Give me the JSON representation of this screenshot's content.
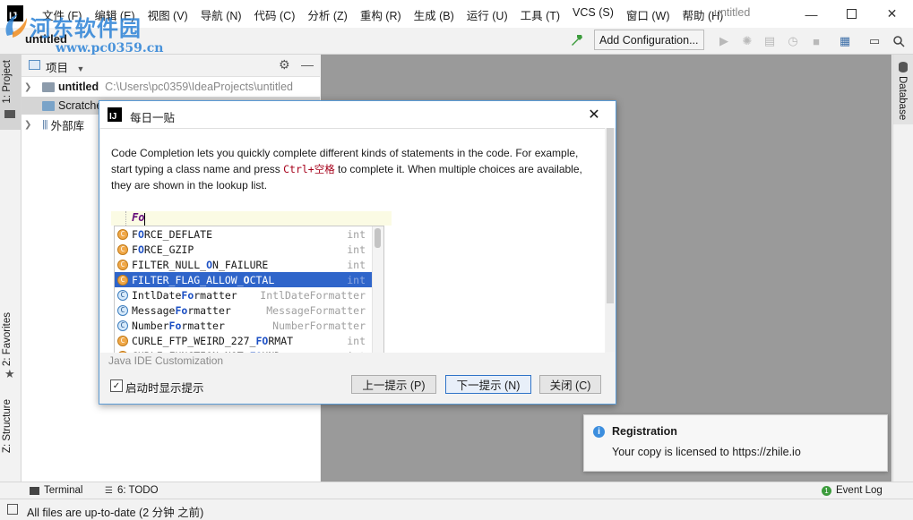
{
  "app": {
    "logo_letter": "IJ",
    "window_title": "untitled"
  },
  "menu": [
    {
      "label": "文件 (F)"
    },
    {
      "label": "编辑 (E)"
    },
    {
      "label": "视图 (V)"
    },
    {
      "label": "导航 (N)"
    },
    {
      "label": "代码 (C)"
    },
    {
      "label": "分析 (Z)"
    },
    {
      "label": "重构 (R)"
    },
    {
      "label": "生成 (B)"
    },
    {
      "label": "运行 (U)"
    },
    {
      "label": "工具 (T)"
    },
    {
      "label": "VCS (S)"
    },
    {
      "label": "窗口 (W)"
    },
    {
      "label": "帮助 (H)"
    }
  ],
  "watermark": {
    "site_name": "河东软件园",
    "url": "www.pc0359.cn"
  },
  "toolbar": {
    "project_crumb": "untitled",
    "add_configuration": "Add Configuration..."
  },
  "left_strip": {
    "project_tab": "1: Project",
    "favorites_tab": "2: Favorites",
    "structure_tab": "Z: Structure"
  },
  "right_strip": {
    "database_tab": "Database"
  },
  "project_panel": {
    "title": "项目",
    "tree": [
      {
        "name": "untitled",
        "path": "C:\\Users\\pc0359\\IdeaProjects\\untitled"
      },
      {
        "name": "Scratches and Consoles"
      },
      {
        "name": "外部库"
      }
    ]
  },
  "dialog": {
    "title": "每日一贴",
    "tip": {
      "part1": "Code Completion lets you quickly complete different kinds of statements in the code. For example, start typing a class name and press ",
      "shortcut": "Ctrl+空格",
      "part2": " to complete it. When multiple choices are available, they are shown in the lookup list."
    },
    "typed_text": "Fo",
    "completions": [
      {
        "icon": "C",
        "kind": "constant",
        "pre": "F",
        "hl": "O",
        "post": "RCE_DEFLATE",
        "type": "int",
        "selected": false
      },
      {
        "icon": "C",
        "kind": "constant",
        "pre": "F",
        "hl": "O",
        "post": "RCE_GZIP",
        "type": "int",
        "selected": false
      },
      {
        "icon": "C",
        "kind": "constant",
        "pre": "FILTER_NULL_",
        "hl": "O",
        "post": "N_FAILURE",
        "type": "int",
        "selected": false
      },
      {
        "icon": "C",
        "kind": "constant",
        "pre": "FILTER_FLAG_ALLOW_",
        "hl": "O",
        "post": "CTAL",
        "type": "int",
        "selected": true
      },
      {
        "icon": "C",
        "kind": "class",
        "pre": "IntlDate",
        "hl": "Fo",
        "post": "rmatter",
        "type": "IntlDateFormatter",
        "selected": false
      },
      {
        "icon": "C",
        "kind": "class",
        "pre": "Message",
        "hl": "Fo",
        "post": "rmatter",
        "type": "MessageFormatter",
        "selected": false
      },
      {
        "icon": "C",
        "kind": "class",
        "pre": "Number",
        "hl": "Fo",
        "post": "rmatter",
        "type": "NumberFormatter",
        "selected": false
      },
      {
        "icon": "C",
        "kind": "constant",
        "pre": "CURLE_FTP_WEIRD_227_",
        "hl": "FO",
        "post": "RMAT",
        "type": "int",
        "selected": false
      },
      {
        "icon": "C",
        "kind": "constant",
        "pre": "CURLE_FUNCTION_NOT_",
        "hl": "FO",
        "post": "UND",
        "type": "int",
        "selected": false
      }
    ],
    "customization": "Java IDE Customization",
    "show_on_startup": "启动时显示提示",
    "show_on_startup_checked": true,
    "prev_button": "上一提示 (P)",
    "next_button": "下一提示 (N)",
    "close_button": "关闭 (C)"
  },
  "notification": {
    "title": "Registration",
    "body": "Your copy is licensed to https://zhile.io"
  },
  "bottom_tools": {
    "terminal": "Terminal",
    "todo": "6: TODO",
    "event_log": "Event Log"
  },
  "status": {
    "text": "All files are up-to-date (2 分钟 之前)"
  }
}
